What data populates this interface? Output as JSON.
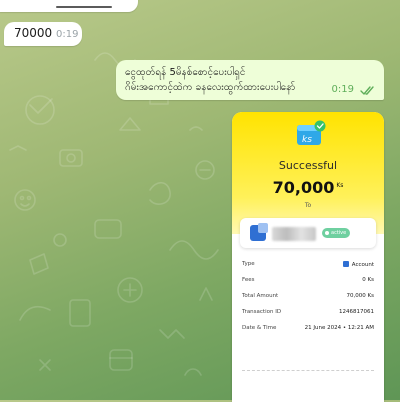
{
  "messages": {
    "incoming": {
      "text": "70000",
      "time": "0:19"
    },
    "outgoing": {
      "line1": "ငွေထုတ်ရန် 5မိနစ်စောင့်ပေးပါရှင်",
      "line2": "ဂိမ်းအကောင့်ထဲက ခနလေးထွက်ထားပေးပါနော်",
      "time": "0:19",
      "status_icon": "double-check-icon"
    }
  },
  "receipt": {
    "brand_mark": "ks",
    "status": "Successful",
    "amount": "70,000",
    "unit": "Ks",
    "to_label": "To",
    "recipient_status": "active",
    "details": [
      {
        "key": "Type",
        "value": "Account",
        "icon": "account-icon"
      },
      {
        "key": "Fees",
        "value": "0 Ks"
      },
      {
        "key": "Total Amount",
        "value": "70,000 Ks"
      },
      {
        "key": "Transaction ID",
        "value": "1246817061"
      },
      {
        "key": "Date & Time",
        "value": "21 June 2024 • 12:21 AM"
      }
    ]
  },
  "colors": {
    "wallpaper": "#8fb36a",
    "outgoing_bubble": "#eefed8",
    "receipt_yellow": "#ffe300",
    "check_green": "#5fae5a"
  }
}
